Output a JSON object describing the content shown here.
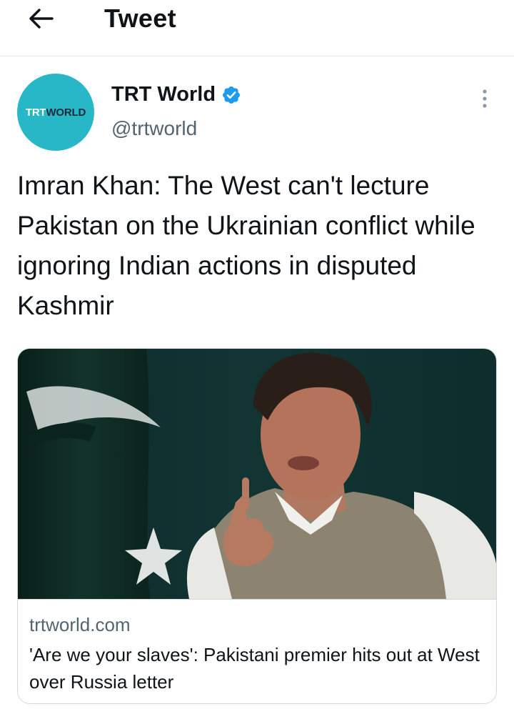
{
  "header": {
    "title": "Tweet"
  },
  "tweet": {
    "author": {
      "name": "TRT World",
      "handle": "@trtworld",
      "avatar_logo_trt": "TRT",
      "avatar_logo_world": "WORLD",
      "avatar_color": "#28b7c7"
    },
    "text": "Imran Khan: The West can't lecture Pakistan on the Ukrainian conflict while ignoring Indian actions in disputed Kashmir",
    "card": {
      "domain": "trtworld.com",
      "title": "'Are we your slaves': Pakistani premier hits out at West over Russia letter"
    }
  },
  "colors": {
    "text_primary": "#0f1419",
    "text_secondary": "#536471",
    "verified_blue": "#1d9bf0",
    "border": "#cfd9de"
  },
  "icons": {
    "back": "arrow-left-icon",
    "verified": "verified-badge-icon",
    "more": "more-vertical-icon"
  }
}
